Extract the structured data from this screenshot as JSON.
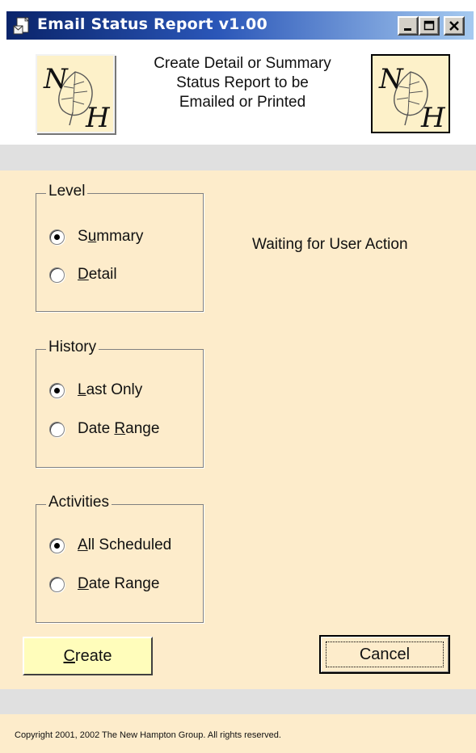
{
  "window": {
    "title": "Email Status Report v1.00",
    "controls": {
      "minimize": "_",
      "maximize": "□",
      "close": "X"
    }
  },
  "header": {
    "description_lines": [
      "Create Detail or Summary",
      "Status Report to be",
      "Emailed or Printed"
    ],
    "logo_letters": [
      "N",
      "H"
    ]
  },
  "level_group": {
    "legend": "Level",
    "options": [
      {
        "pre": "S",
        "accel": "u",
        "post": "mmary",
        "selected": true
      },
      {
        "pre": "",
        "accel": "D",
        "post": "etail",
        "selected": false
      }
    ]
  },
  "history_group": {
    "legend": "History",
    "options": [
      {
        "pre": "",
        "accel": "L",
        "post": "ast Only",
        "selected": true
      },
      {
        "pre": "Date ",
        "accel": "R",
        "post": "ange",
        "selected": false
      }
    ]
  },
  "activities_group": {
    "legend": "Activities",
    "options": [
      {
        "pre": "",
        "accel": "A",
        "post": "ll Scheduled",
        "selected": true
      },
      {
        "pre": "",
        "accel": "D",
        "post": "ate Range",
        "selected": false
      }
    ]
  },
  "status": {
    "text": "Waiting for User Action"
  },
  "buttons": {
    "create": {
      "accel": "C",
      "post": "reate"
    },
    "cancel": {
      "label": "Cancel"
    }
  },
  "footer": {
    "copyright": "Copyright 2001, 2002 The New Hampton Group.  All rights reserved."
  },
  "colors": {
    "title_bar_start": "#0a246a",
    "title_bar_end": "#a6caf0",
    "body_background": "#fdeccb",
    "create_button": "#fffdbb",
    "band": "#e0e0e0"
  }
}
